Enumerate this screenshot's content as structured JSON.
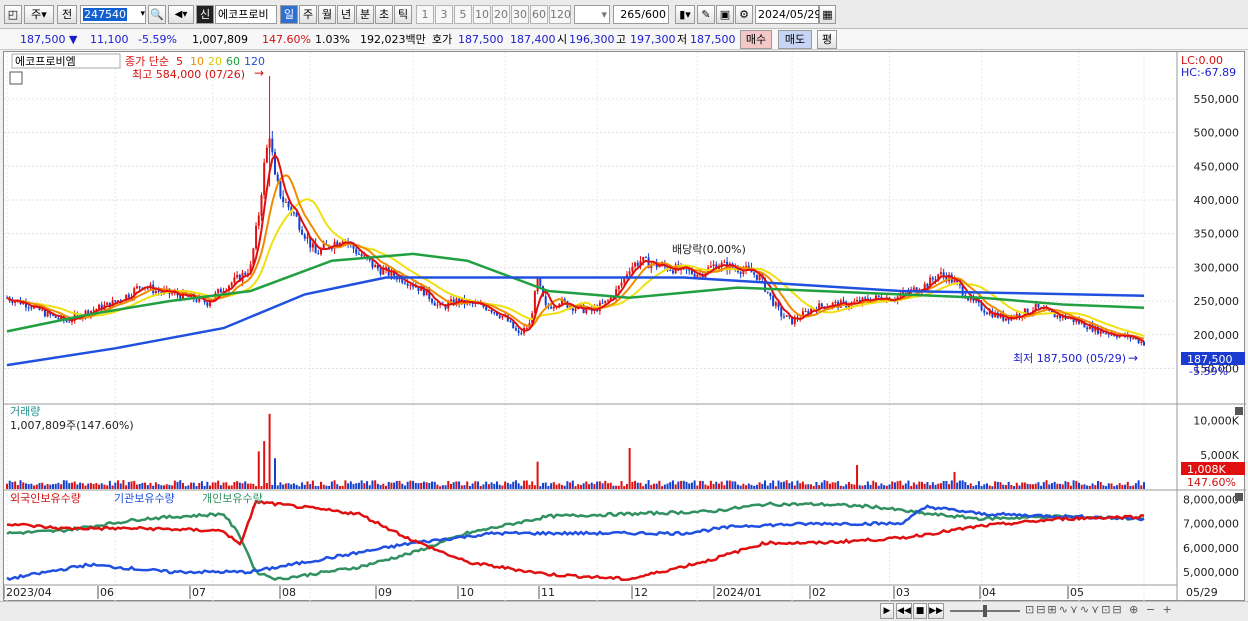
{
  "toolbar": {
    "period_type": "주",
    "prev_label": "전",
    "stock_code": "247540",
    "stock_name": "에코프로비",
    "credit_badge": "신",
    "tabs": [
      "일",
      "주",
      "월",
      "년",
      "분",
      "초",
      "틱"
    ],
    "active_tab": "일",
    "periods": [
      "1",
      "3",
      "5",
      "10",
      "20",
      "30",
      "60",
      "120"
    ],
    "count": "265",
    "count_total": "/600",
    "date": "2024/05/29"
  },
  "quote": {
    "price": "187,500",
    "change": "11,100",
    "change_pct": "-5.59%",
    "volume": "1,007,809",
    "volume_ratio": "147.60%",
    "turnover": "1.03%",
    "amount": "192,023백만",
    "ask_label": "호가",
    "ask": "187,500",
    "bid": "187,400",
    "open_label": "시",
    "open": "196,300",
    "high_label": "고",
    "high": "197,300",
    "low_label": "저",
    "low": "187,500",
    "buy_label": "매수",
    "sell_label": "매도",
    "eval_label": "평"
  },
  "price_panel": {
    "stock_name": "에코프로비엠",
    "ma_label": "종가 단순",
    "ma_periods": [
      "5",
      "10",
      "20",
      "60",
      "120"
    ],
    "high_note": "최고 584,000 (07/26)",
    "low_note": "최저 187,500 (05/29)",
    "dividend_note": "배당락(0.00%)",
    "lc": "LC:0.00",
    "hc": "HC:-67.89",
    "y_ticks": [
      "550,000",
      "500,000",
      "450,000",
      "400,000",
      "350,000",
      "300,000",
      "250,000",
      "200,000",
      "150,000"
    ],
    "last_price": "187,500",
    "last_change": "-5.59%"
  },
  "volume_panel": {
    "title": "거래량",
    "current": "1,007,809주(147.60%)",
    "y_ticks": [
      "10,000K",
      "5,000K"
    ],
    "last": "1,008K",
    "last_pct": "147.60%"
  },
  "holding_panel": {
    "series": [
      "외국인보유수량",
      "기관보유수량",
      "개인보유수량"
    ],
    "y_ticks": [
      "8,000,000",
      "7,000,000",
      "6,000,000",
      "5,000,000"
    ]
  },
  "x_axis": [
    "2023/04",
    "06",
    "07",
    "08",
    "09",
    "10",
    "11",
    "12",
    "2024/01",
    "02",
    "03",
    "04",
    "05",
    "05/29"
  ],
  "colors": {
    "up": "#e01010",
    "down": "#1440d0",
    "ma5": "#e01010",
    "ma10": "#f08c00",
    "ma20": "#f0e010",
    "ma60": "#20a040",
    "ma120": "#2050e0",
    "foreign": "#e01010",
    "institution": "#2050e0",
    "individual": "#309060"
  },
  "chart_data": {
    "type": "candlestick",
    "price_line": [
      [
        0,
        255000
      ],
      [
        8,
        245000
      ],
      [
        15,
        230000
      ],
      [
        22,
        220000
      ],
      [
        30,
        235000
      ],
      [
        38,
        245000
      ],
      [
        45,
        260000
      ],
      [
        50,
        275000
      ],
      [
        55,
        265000
      ],
      [
        62,
        260000
      ],
      [
        68,
        255000
      ],
      [
        74,
        248000
      ],
      [
        80,
        270000
      ],
      [
        86,
        285000
      ],
      [
        90,
        300000
      ],
      [
        93,
        380000
      ],
      [
        95,
        450000
      ],
      [
        97,
        500000
      ],
      [
        99,
        430000
      ],
      [
        102,
        400000
      ],
      [
        106,
        380000
      ],
      [
        110,
        350000
      ],
      [
        114,
        320000
      ],
      [
        118,
        330000
      ],
      [
        124,
        345000
      ],
      [
        130,
        320000
      ],
      [
        136,
        300000
      ],
      [
        142,
        290000
      ],
      [
        148,
        280000
      ],
      [
        154,
        265000
      ],
      [
        160,
        240000
      ],
      [
        166,
        250000
      ],
      [
        172,
        245000
      ],
      [
        178,
        240000
      ],
      [
        184,
        225000
      ],
      [
        189,
        200000
      ],
      [
        193,
        215000
      ],
      [
        196,
        280000
      ],
      [
        199,
        240000
      ],
      [
        204,
        250000
      ],
      [
        210,
        240000
      ],
      [
        216,
        235000
      ],
      [
        222,
        250000
      ],
      [
        226,
        270000
      ],
      [
        230,
        300000
      ],
      [
        234,
        310000
      ],
      [
        238,
        305000
      ],
      [
        244,
        300000
      ],
      [
        250,
        295000
      ],
      [
        256,
        290000
      ],
      [
        262,
        305000
      ],
      [
        268,
        300000
      ],
      [
        274,
        295000
      ],
      [
        278,
        285000
      ],
      [
        282,
        255000
      ],
      [
        286,
        230000
      ],
      [
        290,
        220000
      ],
      [
        294,
        230000
      ],
      [
        298,
        240000
      ],
      [
        304,
        245000
      ],
      [
        310,
        245000
      ],
      [
        316,
        250000
      ],
      [
        322,
        255000
      ],
      [
        328,
        255000
      ],
      [
        334,
        265000
      ],
      [
        340,
        275000
      ],
      [
        344,
        290000
      ],
      [
        348,
        285000
      ],
      [
        352,
        270000
      ],
      [
        356,
        250000
      ],
      [
        362,
        235000
      ],
      [
        368,
        225000
      ],
      [
        374,
        230000
      ],
      [
        380,
        240000
      ],
      [
        386,
        230000
      ],
      [
        392,
        225000
      ],
      [
        398,
        215000
      ],
      [
        404,
        205000
      ],
      [
        410,
        200000
      ],
      [
        416,
        195000
      ],
      [
        420,
        187500
      ]
    ],
    "ma120": [
      [
        0,
        155000
      ],
      [
        40,
        180000
      ],
      [
        80,
        210000
      ],
      [
        110,
        260000
      ],
      [
        140,
        285000
      ],
      [
        170,
        285000
      ],
      [
        210,
        285000
      ],
      [
        250,
        285000
      ],
      [
        290,
        275000
      ],
      [
        330,
        265000
      ],
      [
        370,
        262000
      ],
      [
        420,
        258000
      ]
    ],
    "ma60": [
      [
        0,
        205000
      ],
      [
        30,
        230000
      ],
      [
        60,
        250000
      ],
      [
        90,
        265000
      ],
      [
        120,
        310000
      ],
      [
        150,
        320000
      ],
      [
        170,
        310000
      ],
      [
        200,
        265000
      ],
      [
        230,
        255000
      ],
      [
        270,
        270000
      ],
      [
        300,
        265000
      ],
      [
        330,
        260000
      ],
      [
        360,
        255000
      ],
      [
        390,
        245000
      ],
      [
        420,
        240000
      ]
    ],
    "volume_spikes": [
      [
        93,
        5500
      ],
      [
        95,
        7000
      ],
      [
        97,
        11000
      ],
      [
        99,
        4500
      ],
      [
        196,
        4000
      ],
      [
        230,
        6000
      ],
      [
        314,
        3500
      ],
      [
        350,
        2500
      ],
      [
        420,
        1008
      ]
    ],
    "foreign": [
      [
        0,
        7000000
      ],
      [
        20,
        6800000
      ],
      [
        50,
        6800000
      ],
      [
        80,
        6700000
      ],
      [
        86,
        6100000
      ],
      [
        92,
        7900000
      ],
      [
        100,
        7800000
      ],
      [
        130,
        7400000
      ],
      [
        150,
        6300000
      ],
      [
        170,
        5400000
      ],
      [
        200,
        4900000
      ],
      [
        230,
        4700000
      ],
      [
        260,
        5500000
      ],
      [
        280,
        6200000
      ],
      [
        300,
        6200000
      ],
      [
        330,
        6400000
      ],
      [
        360,
        6900000
      ],
      [
        390,
        7200000
      ],
      [
        420,
        7300000
      ]
    ],
    "institution": [
      [
        0,
        4700000
      ],
      [
        30,
        5300000
      ],
      [
        60,
        5000000
      ],
      [
        90,
        5000000
      ],
      [
        120,
        5600000
      ],
      [
        150,
        6200000
      ],
      [
        180,
        6600000
      ],
      [
        220,
        6600000
      ],
      [
        250,
        6600000
      ],
      [
        270,
        6900000
      ],
      [
        300,
        7000000
      ],
      [
        330,
        7000000
      ],
      [
        340,
        7700000
      ],
      [
        360,
        7400000
      ],
      [
        390,
        7300000
      ],
      [
        420,
        7200000
      ]
    ],
    "individual": [
      [
        0,
        6600000
      ],
      [
        20,
        6700000
      ],
      [
        50,
        7200000
      ],
      [
        80,
        7400000
      ],
      [
        86,
        6500000
      ],
      [
        92,
        5000000
      ],
      [
        100,
        4700000
      ],
      [
        130,
        5200000
      ],
      [
        150,
        5800000
      ],
      [
        170,
        6600000
      ],
      [
        200,
        7300000
      ],
      [
        230,
        7400000
      ],
      [
        260,
        7500000
      ],
      [
        280,
        7800000
      ],
      [
        300,
        7800000
      ],
      [
        320,
        7700000
      ],
      [
        340,
        7400000
      ],
      [
        360,
        7200000
      ],
      [
        390,
        7300000
      ],
      [
        420,
        7200000
      ]
    ]
  }
}
